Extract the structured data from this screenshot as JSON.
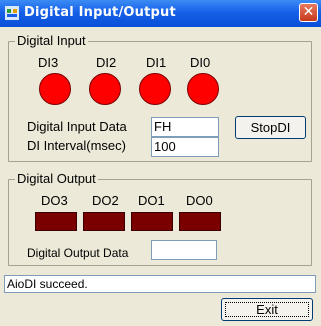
{
  "window": {
    "title": "Digital Input/Output",
    "close_glyph": "✕"
  },
  "digital_input": {
    "group_title": "Digital Input",
    "channels": [
      {
        "label": "DI3",
        "state_color": "#ff0000"
      },
      {
        "label": "DI2",
        "state_color": "#ff0000"
      },
      {
        "label": "DI1",
        "state_color": "#ff0000"
      },
      {
        "label": "DI0",
        "state_color": "#ff0000"
      }
    ],
    "data_label": "Digital Input Data",
    "data_value": "FH",
    "interval_label": "DI Interval(msec)",
    "interval_value": "100",
    "stop_button": "StopDI"
  },
  "digital_output": {
    "group_title": "Digital Output",
    "channels": [
      {
        "label": "DO3",
        "state_color": "#7a0000"
      },
      {
        "label": "DO2",
        "state_color": "#7a0000"
      },
      {
        "label": "DO1",
        "state_color": "#7a0000"
      },
      {
        "label": "DO0",
        "state_color": "#7a0000"
      }
    ],
    "data_label": "Digital Output Data",
    "data_value": ""
  },
  "status": {
    "text": "AioDI succeed."
  },
  "exit_button": "Exit"
}
